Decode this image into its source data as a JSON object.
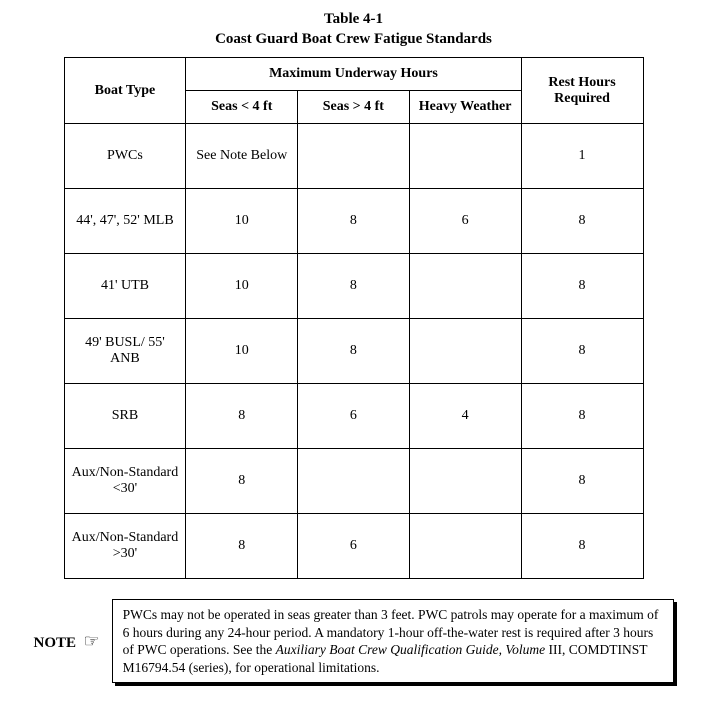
{
  "caption": {
    "line1": "Table 4-1",
    "line2": "Coast Guard Boat Crew Fatigue Standards"
  },
  "headers": {
    "boat_type": "Boat Type",
    "max_underway": "Maximum Underway Hours",
    "seas_lt4": "Seas < 4 ft",
    "seas_gt4": "Seas > 4 ft",
    "heavy_weather": "Heavy Weather",
    "rest_hours": "Rest Hours Required"
  },
  "rows": [
    {
      "boat": "PWCs",
      "seas_lt4": "See Note Below",
      "seas_gt4": "",
      "heavy": "",
      "rest": "1"
    },
    {
      "boat": "44', 47', 52' MLB",
      "seas_lt4": "10",
      "seas_gt4": "8",
      "heavy": "6",
      "rest": "8"
    },
    {
      "boat": "41' UTB",
      "seas_lt4": "10",
      "seas_gt4": "8",
      "heavy": "",
      "rest": "8"
    },
    {
      "boat": "49' BUSL/ 55' ANB",
      "seas_lt4": "10",
      "seas_gt4": "8",
      "heavy": "",
      "rest": "8"
    },
    {
      "boat": "SRB",
      "seas_lt4": "8",
      "seas_gt4": "6",
      "heavy": "4",
      "rest": "8"
    },
    {
      "boat": "Aux/Non-Standard <30'",
      "seas_lt4": "8",
      "seas_gt4": "",
      "heavy": "",
      "rest": "8"
    },
    {
      "boat": "Aux/Non-Standard >30'",
      "seas_lt4": "8",
      "seas_gt4": "6",
      "heavy": "",
      "rest": "8"
    }
  ],
  "note": {
    "label": "NOTE",
    "icon_glyph": "☞",
    "text_before_italic": "PWCs may not be operated in seas greater than 3 feet.  PWC patrols may operate for a maximum of 6 hours during any 24-hour period.  A mandatory 1-hour off-the-water rest is required after 3 hours of PWC operations.  See the ",
    "italic": "Auxiliary Boat Crew Qualification Guide, Volume",
    "text_after_italic": " III, COMDTINST M16794.54 (series), for operational limitations."
  },
  "chart_data": {
    "type": "table",
    "title": "Coast Guard Boat Crew Fatigue Standards",
    "columns": [
      "Boat Type",
      "Seas < 4 ft",
      "Seas > 4 ft",
      "Heavy Weather",
      "Rest Hours Required"
    ],
    "rows": [
      [
        "PWCs",
        "See Note Below",
        "",
        "",
        1
      ],
      [
        "44', 47', 52' MLB",
        10,
        8,
        6,
        8
      ],
      [
        "41' UTB",
        10,
        8,
        "",
        8
      ],
      [
        "49' BUSL/ 55' ANB",
        10,
        8,
        "",
        8
      ],
      [
        "SRB",
        8,
        6,
        4,
        8
      ],
      [
        "Aux/Non-Standard <30'",
        8,
        "",
        "",
        8
      ],
      [
        "Aux/Non-Standard >30'",
        8,
        6,
        "",
        8
      ]
    ]
  }
}
